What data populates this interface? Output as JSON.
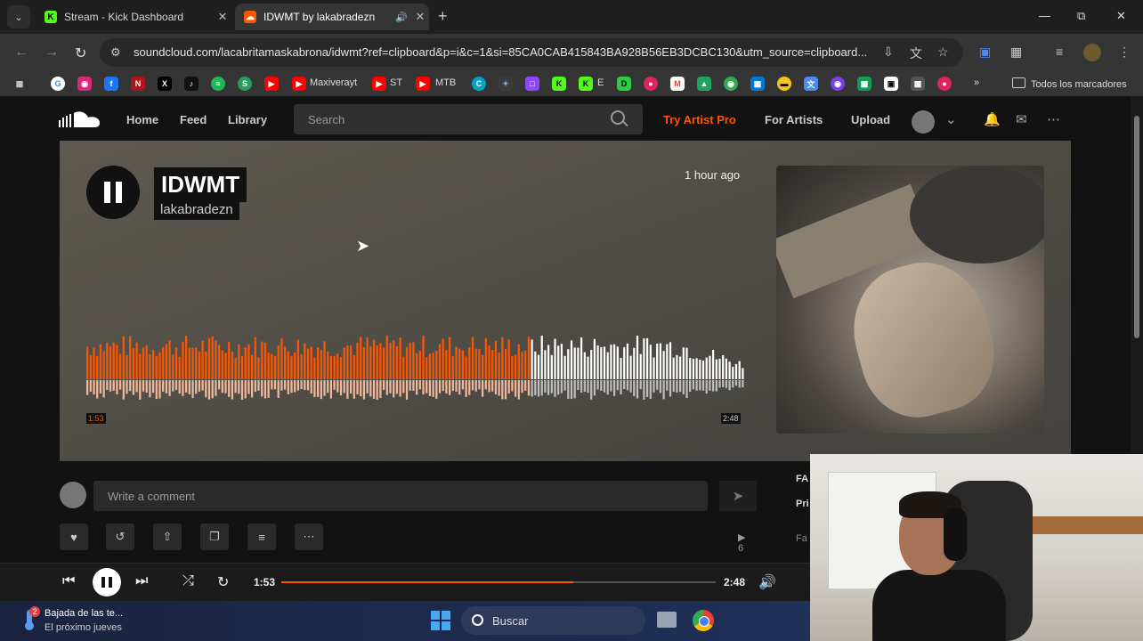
{
  "browser": {
    "tabs": [
      {
        "title": "Stream - Kick Dashboard",
        "favicon": "kick-icon",
        "color": "#53fc18"
      },
      {
        "title": "IDWMT by lakabradezn",
        "favicon": "soundcloud-icon",
        "color": "#ff5500",
        "audio": true
      }
    ],
    "url": "soundcloud.com/lacabritamaskabrona/idwmt?ref=clipboard&p=i&c=1&si=85CA0CAB415843BA928B56EB3DCBC130&utm_source=clipboard...",
    "bookmarks": [
      {
        "label": "Maxiverayt"
      },
      {
        "label": "ST"
      },
      {
        "label": "MTB"
      },
      {
        "label": "E"
      }
    ],
    "all_bookmarks": "Todos los marcadores"
  },
  "soundcloud": {
    "nav": {
      "home": "Home",
      "feed": "Feed",
      "library": "Library"
    },
    "search_placeholder": "Search",
    "try_artist_pro": "Try Artist Pro",
    "for_artists": "For Artists",
    "upload": "Upload",
    "track": {
      "title": "IDWMT",
      "artist": "lakabradezn",
      "posted": "1 hour ago",
      "current_time": "1:53",
      "duration": "2:48",
      "progress": 0.673
    },
    "comment_placeholder": "Write a comment",
    "plays": "6",
    "side_labels": [
      "FA",
      "Pri",
      "Fa"
    ]
  },
  "player": {
    "current_time": "1:53",
    "duration": "2:48",
    "progress": 0.673
  },
  "taskbar": {
    "weather_badge": "2",
    "weather_line1": "Bajada de las te...",
    "weather_line2": "El próximo jueves",
    "search": "Buscar"
  },
  "colors": {
    "accent": "#ff5500",
    "hero_bg": "#56534d"
  }
}
